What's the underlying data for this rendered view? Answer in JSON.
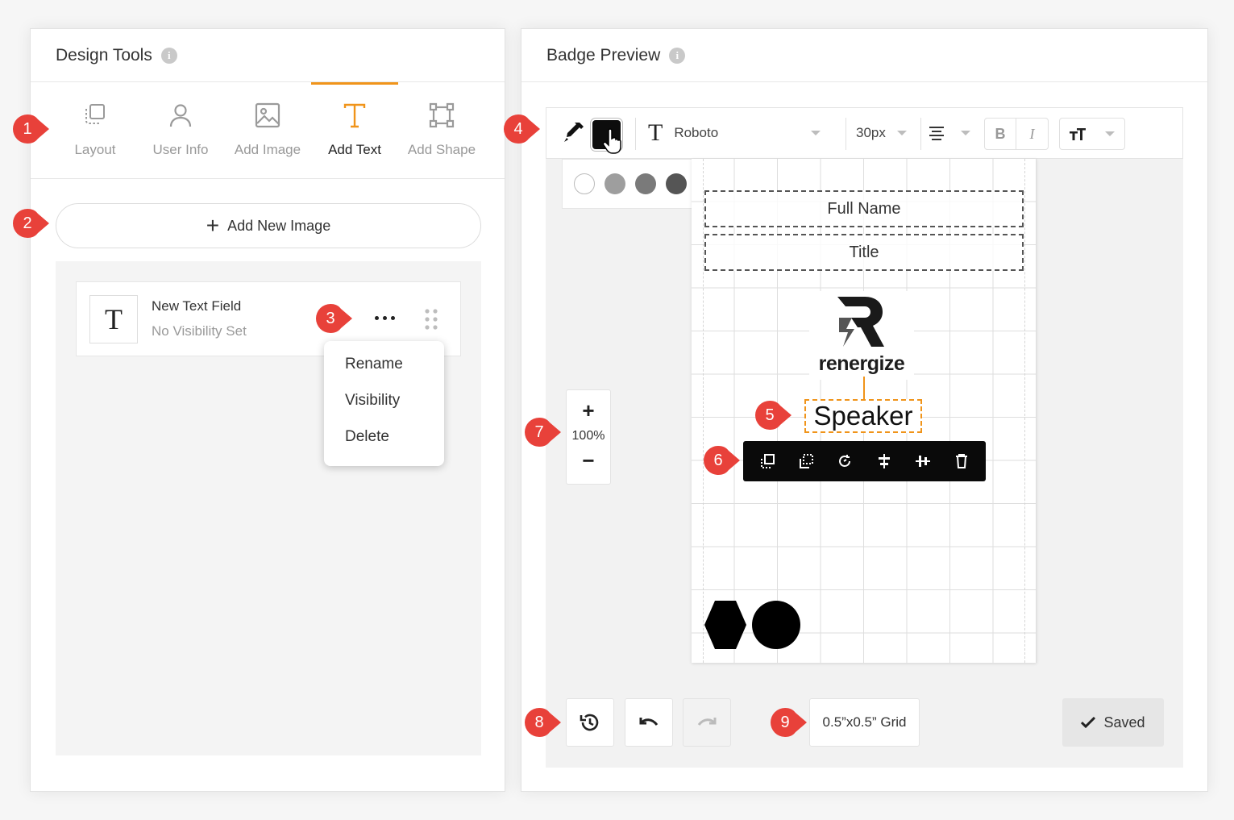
{
  "left_panel": {
    "title": "Design Tools",
    "info_icon": "i",
    "tabs": [
      {
        "label": "Layout",
        "icon": "layout-icon",
        "active": false
      },
      {
        "label": "User Info",
        "icon": "user-icon",
        "active": false
      },
      {
        "label": "Add Image",
        "icon": "image-icon",
        "active": false
      },
      {
        "label": "Add Text",
        "icon": "text-icon",
        "active": true
      },
      {
        "label": "Add Shape",
        "icon": "shape-icon",
        "active": false
      }
    ],
    "add_button": {
      "label": "Add New Image",
      "icon": "plus-icon"
    },
    "field": {
      "icon_glyph": "T",
      "name": "New Text Field",
      "visibility": "No Visibility Set"
    },
    "context_menu": [
      "Rename",
      "Visibility",
      "Delete"
    ]
  },
  "right_panel": {
    "title": "Badge Preview",
    "info_icon": "i",
    "toolbar": {
      "font_icon_glyph": "T",
      "font": "Roboto",
      "font_size": "30px",
      "bold": "B",
      "italic": "I"
    },
    "color_swatches": [
      "#ffffff",
      "#9e9e9e",
      "#7a7a7a",
      "#555555",
      "#333333",
      "#1a1a1a",
      "#000000"
    ],
    "badge": {
      "full_name": "Full Name",
      "title": "Title",
      "logo_text": "renergize",
      "speaker": "Speaker"
    },
    "zoom": {
      "plus": "+",
      "level": "100%",
      "minus": "−"
    },
    "grid_label": "0.5”x0.5” Grid",
    "saved_label": "Saved"
  },
  "markers": [
    "1",
    "2",
    "3",
    "4",
    "5",
    "6",
    "7",
    "8",
    "9"
  ],
  "colors": {
    "accent": "#f0941a",
    "marker": "#e8413a",
    "selected_color": "#0d0d0d"
  }
}
